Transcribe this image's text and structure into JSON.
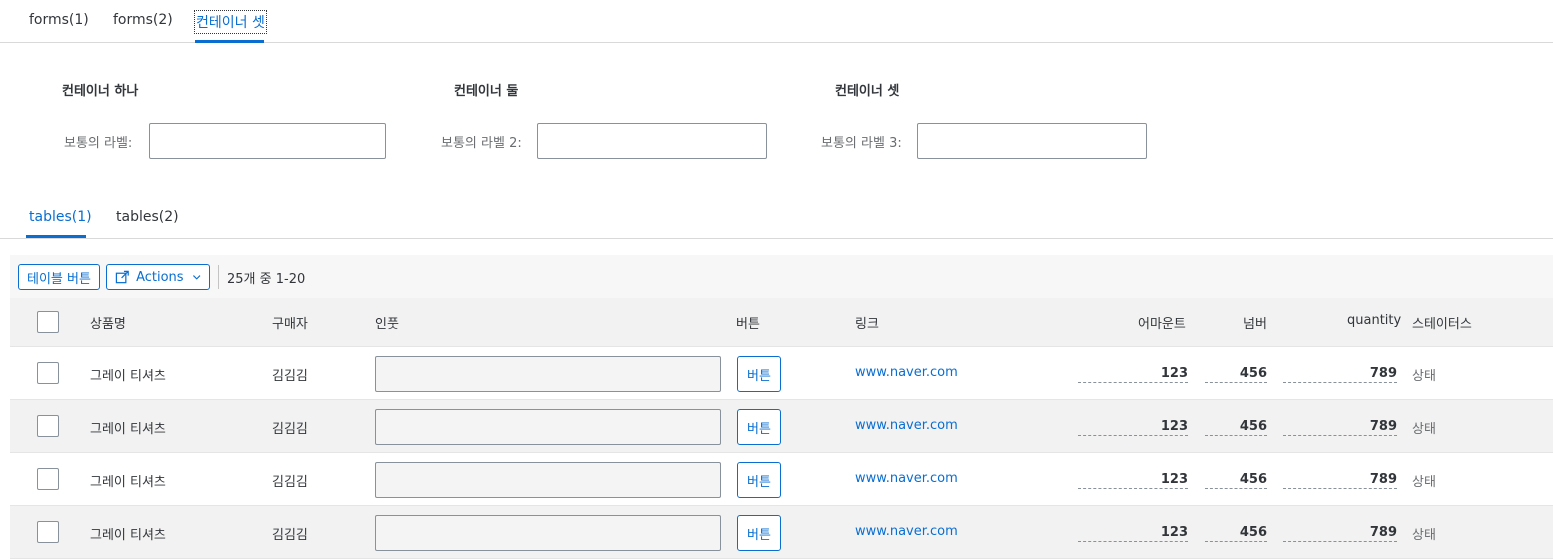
{
  "top_tabs": [
    {
      "label": "forms(1)"
    },
    {
      "label": "forms(2)"
    },
    {
      "label": "컨테이너 셋"
    }
  ],
  "forms": [
    {
      "title": "컨테이너 하나",
      "label": "보통의 라벨:",
      "value": ""
    },
    {
      "title": "컨테이너 둘",
      "label": "보통의 라벨 2:",
      "value": ""
    },
    {
      "title": "컨테이너 셋",
      "label": "보통의 라벨 3:",
      "value": ""
    }
  ],
  "table_tabs": [
    {
      "label": "tables(1)"
    },
    {
      "label": "tables(2)"
    }
  ],
  "toolbar": {
    "table_button": "테이블 버튼",
    "actions": "Actions",
    "count": "25개 중 1-20"
  },
  "table": {
    "headers": {
      "product": "상품명",
      "buyer": "구매자",
      "input": "인풋",
      "button": "버튼",
      "link": "링크",
      "amount": "어마운트",
      "number": "넘버",
      "quantity": "quantity",
      "status": "스테이터스"
    },
    "rows": [
      {
        "product": "그레이 티셔츠",
        "buyer": "김김김",
        "input": "",
        "button": "버튼",
        "link": "www.naver.com",
        "amount": "123",
        "number": "456",
        "quantity": "789",
        "status": "상태"
      },
      {
        "product": "그레이 티셔츠",
        "buyer": "김김김",
        "input": "",
        "button": "버튼",
        "link": "www.naver.com",
        "amount": "123",
        "number": "456",
        "quantity": "789",
        "status": "상태"
      },
      {
        "product": "그레이 티셔츠",
        "buyer": "김김김",
        "input": "",
        "button": "버튼",
        "link": "www.naver.com",
        "amount": "123",
        "number": "456",
        "quantity": "789",
        "status": "상태"
      },
      {
        "product": "그레이 티셔츠",
        "buyer": "김김김",
        "input": "",
        "button": "버튼",
        "link": "www.naver.com",
        "amount": "123",
        "number": "456",
        "quantity": "789",
        "status": "상태"
      }
    ]
  },
  "colors": {
    "accent": "#0a6ed1",
    "text": "#32363a",
    "row_alt": "#f2f2f2"
  }
}
